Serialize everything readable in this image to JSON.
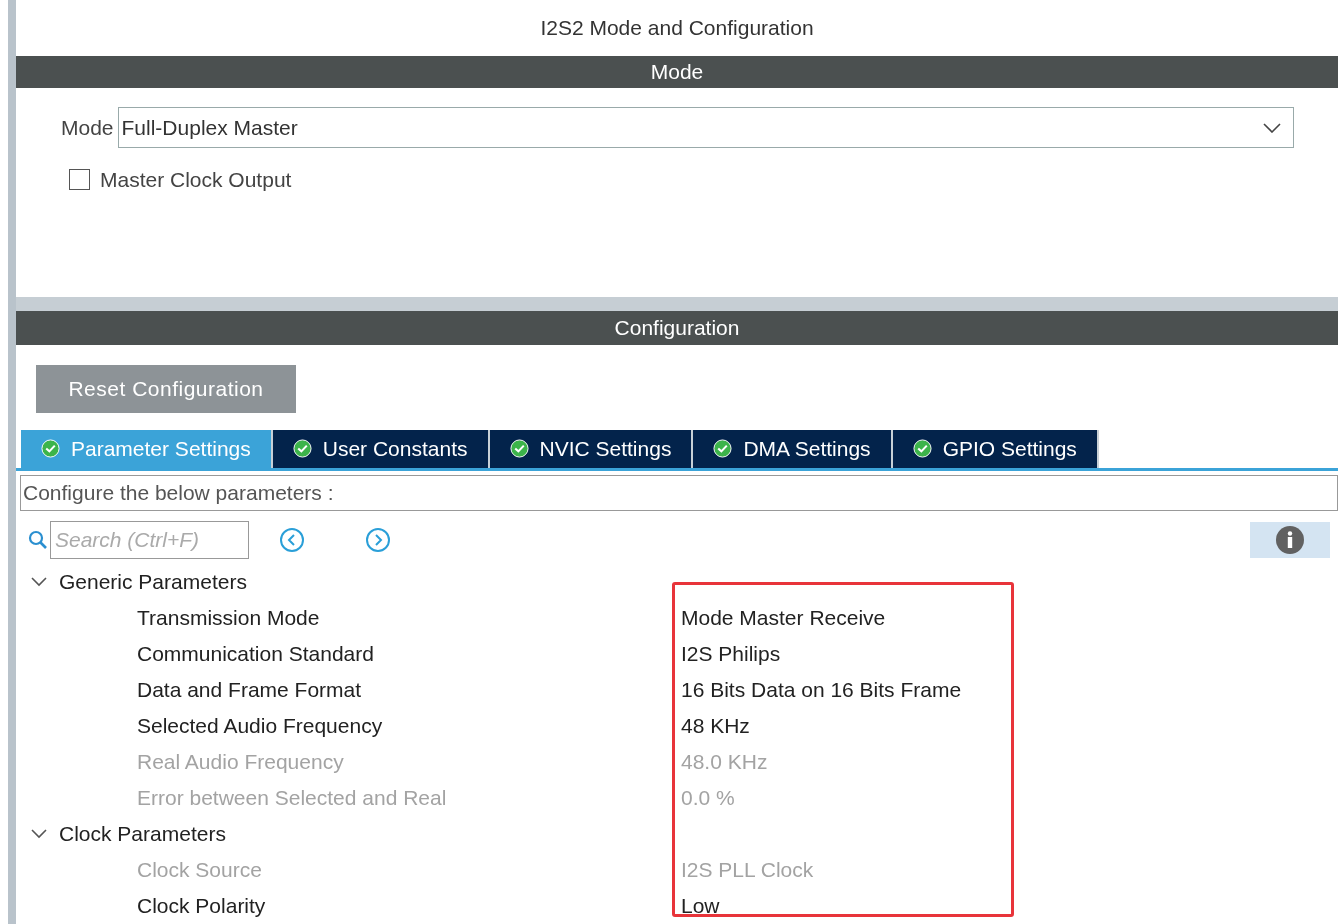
{
  "title": "I2S2 Mode and Configuration",
  "mode_section": {
    "header": "Mode",
    "mode_label": "Mode",
    "mode_value": "Full-Duplex Master",
    "master_clock_output": {
      "label": "Master Clock Output",
      "checked": false
    }
  },
  "configuration_section": {
    "header": "Configuration",
    "reset_button": "Reset Configuration",
    "tabs": [
      {
        "label": "Parameter Settings",
        "selected": true
      },
      {
        "label": "User Constants",
        "selected": false
      },
      {
        "label": "NVIC Settings",
        "selected": false
      },
      {
        "label": "DMA Settings",
        "selected": false
      },
      {
        "label": "GPIO Settings",
        "selected": false
      }
    ],
    "hint": "Configure the below parameters :",
    "search": {
      "placeholder": "Search (Ctrl+F)"
    },
    "groups": [
      {
        "label": "Generic Parameters",
        "expanded": true,
        "children": [
          {
            "name": "Transmission Mode",
            "value": "Mode Master Receive",
            "disabled": false
          },
          {
            "name": "Communication Standard",
            "value": "I2S Philips",
            "disabled": false
          },
          {
            "name": "Data and Frame Format",
            "value": "16 Bits Data on 16 Bits Frame",
            "disabled": false
          },
          {
            "name": "Selected Audio Frequency",
            "value": "48 KHz",
            "disabled": false
          },
          {
            "name": "Real Audio Frequency",
            "value": "48.0 KHz",
            "disabled": true
          },
          {
            "name": "Error between Selected and Real",
            "value": "0.0 %",
            "disabled": true
          }
        ]
      },
      {
        "label": "Clock Parameters",
        "expanded": true,
        "children": [
          {
            "name": "Clock Source",
            "value": "I2S PLL Clock",
            "disabled": true
          },
          {
            "name": "Clock Polarity",
            "value": "Low",
            "disabled": false
          }
        ]
      }
    ]
  }
}
